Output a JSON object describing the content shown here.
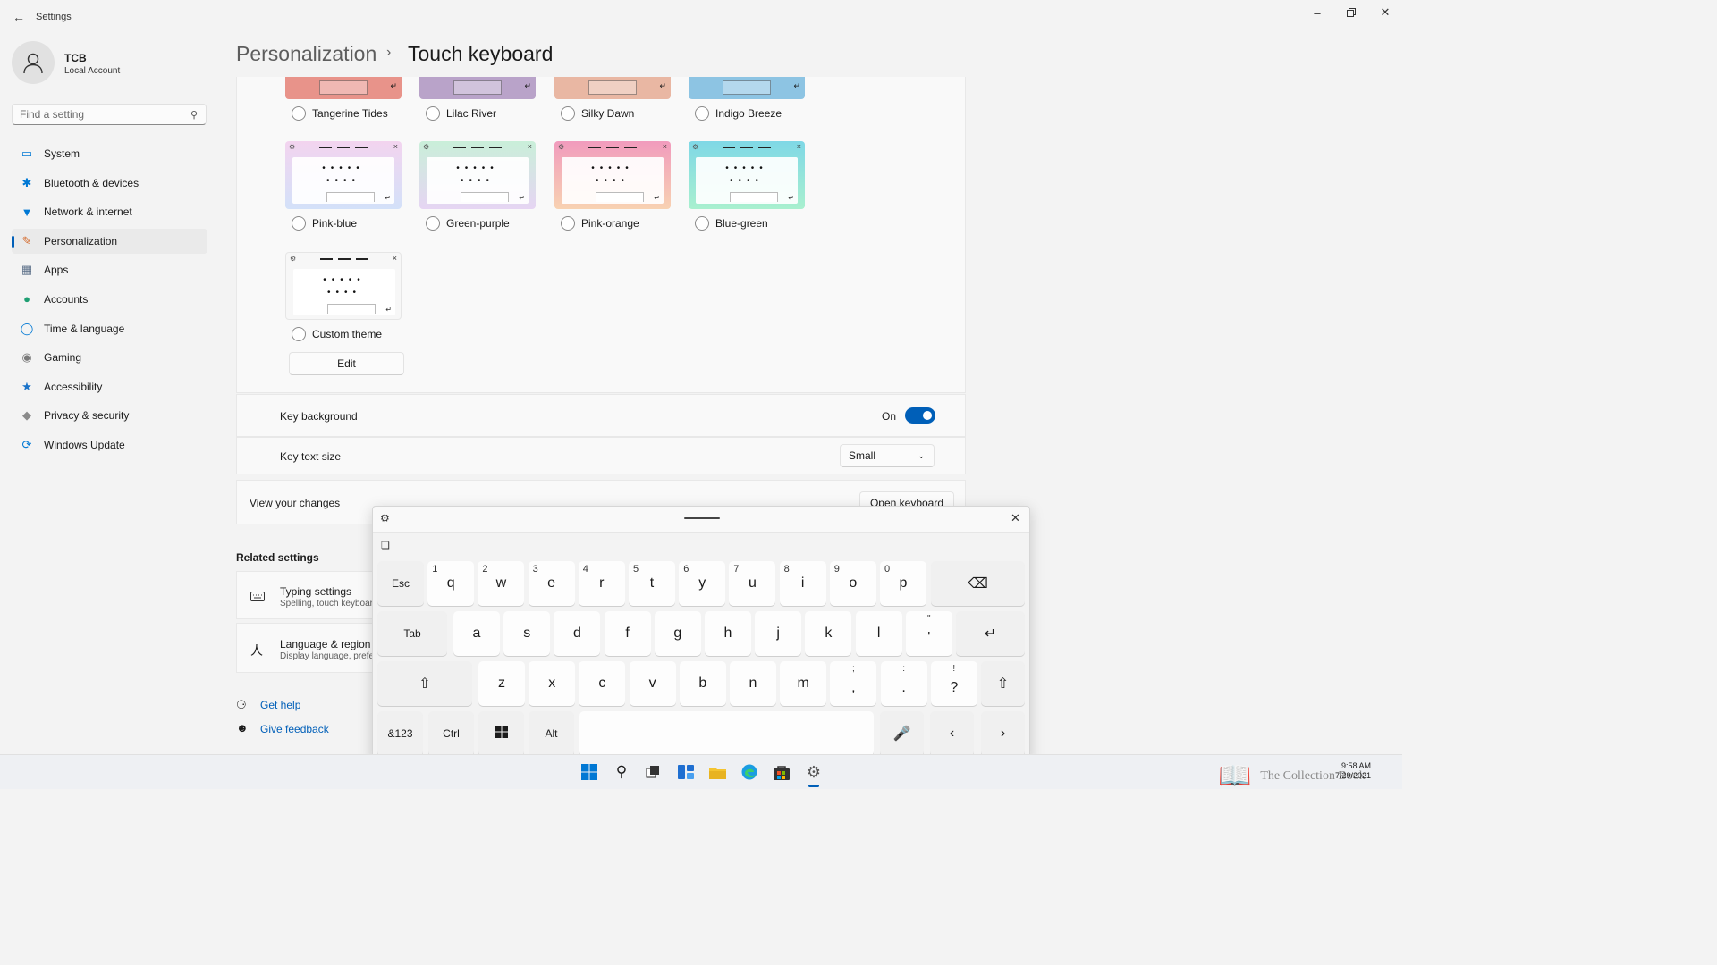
{
  "window": {
    "title": "Settings",
    "controls": [
      "minimize",
      "maximize",
      "close"
    ]
  },
  "user": {
    "name": "TCB",
    "account_type": "Local Account"
  },
  "search": {
    "placeholder": "Find a setting"
  },
  "nav": {
    "items": [
      {
        "label": "System",
        "icon": "system-icon",
        "color": "#0078d4"
      },
      {
        "label": "Bluetooth & devices",
        "icon": "bluetooth-icon",
        "color": "#0078d4"
      },
      {
        "label": "Network & internet",
        "icon": "wifi-icon",
        "color": "#0078d4"
      },
      {
        "label": "Personalization",
        "icon": "brush-icon",
        "color": "#d46a2c",
        "active": true
      },
      {
        "label": "Apps",
        "icon": "apps-icon",
        "color": "#5b6f88"
      },
      {
        "label": "Accounts",
        "icon": "person-icon",
        "color": "#1e9e72"
      },
      {
        "label": "Time & language",
        "icon": "globe-clock-icon",
        "color": "#0078d4"
      },
      {
        "label": "Gaming",
        "icon": "gamepad-icon",
        "color": "#7a7a7a"
      },
      {
        "label": "Accessibility",
        "icon": "accessibility-icon",
        "color": "#1a73c9"
      },
      {
        "label": "Privacy & security",
        "icon": "shield-icon",
        "color": "#8a8a8a"
      },
      {
        "label": "Windows Update",
        "icon": "update-icon",
        "color": "#0078d4"
      }
    ]
  },
  "header": {
    "parent": "Personalization",
    "separator": "›",
    "current": "Touch keyboard"
  },
  "themes": {
    "top_row": [
      {
        "name": "Tangerine Tides",
        "color": "#e8938a"
      },
      {
        "name": "Lilac River",
        "color": "#b9a3c9"
      },
      {
        "name": "Silky Dawn",
        "color": "#e9b7a3"
      },
      {
        "name": "Indigo Breeze",
        "color": "#8dc4e3"
      }
    ],
    "grid": [
      {
        "name": "Pink-blue",
        "from": "#f3d4ef",
        "to": "#d3e1f9"
      },
      {
        "name": "Green-purple",
        "from": "#c9efd9",
        "to": "#e6d5f3"
      },
      {
        "name": "Pink-orange",
        "from": "#f19bbd",
        "to": "#f8d2b2"
      },
      {
        "name": "Blue-green",
        "from": "#7fd8e6",
        "to": "#a9f0cf"
      },
      {
        "name": "Custom theme",
        "from": "#f7f7f7",
        "to": "#f7f7f7"
      }
    ],
    "edit_label": "Edit"
  },
  "settings": {
    "key_background": {
      "label": "Key background",
      "state": "On"
    },
    "key_text_size": {
      "label": "Key text size",
      "value": "Small"
    },
    "view_changes": {
      "label": "View your changes",
      "button": "Open keyboard"
    }
  },
  "related": {
    "title": "Related settings",
    "items": [
      {
        "title": "Typing settings",
        "subtitle": "Spelling, touch keyboar",
        "icon": "keyboard-icon"
      },
      {
        "title": "Language & region",
        "subtitle": "Display language, prefe",
        "icon": "language-icon"
      }
    ]
  },
  "links": {
    "help": "Get help",
    "feedback": "Give feedback"
  },
  "keyboard": {
    "row1": [
      {
        "k": "Esc",
        "small": true
      },
      {
        "k": "q",
        "h": "1"
      },
      {
        "k": "w",
        "h": "2"
      },
      {
        "k": "e",
        "h": "3"
      },
      {
        "k": "r",
        "h": "4"
      },
      {
        "k": "t",
        "h": "5"
      },
      {
        "k": "y",
        "h": "6"
      },
      {
        "k": "u",
        "h": "7"
      },
      {
        "k": "i",
        "h": "8"
      },
      {
        "k": "o",
        "h": "9"
      },
      {
        "k": "p",
        "h": "0"
      }
    ],
    "row2": [
      {
        "k": "Tab",
        "small": true
      },
      {
        "k": "a"
      },
      {
        "k": "s"
      },
      {
        "k": "d"
      },
      {
        "k": "f"
      },
      {
        "k": "g"
      },
      {
        "k": "h"
      },
      {
        "k": "j"
      },
      {
        "k": "k"
      },
      {
        "k": "l"
      },
      {
        "k": "'",
        "hc": "\""
      }
    ],
    "row3": [
      {
        "k": "z"
      },
      {
        "k": "x"
      },
      {
        "k": "c"
      },
      {
        "k": "v"
      },
      {
        "k": "b"
      },
      {
        "k": "n"
      },
      {
        "k": "m"
      },
      {
        "k": ",",
        "hc": ";"
      },
      {
        "k": ".",
        "hc": ":"
      },
      {
        "k": "?",
        "hc": "!"
      }
    ],
    "row4": {
      "symbols": "&123",
      "ctrl": "Ctrl",
      "alt": "Alt",
      "left": "‹",
      "right": "›"
    }
  },
  "taskbar": {
    "time": "9:58 AM",
    "date": "7/29/2021",
    "watermark": "The Collection Book"
  }
}
